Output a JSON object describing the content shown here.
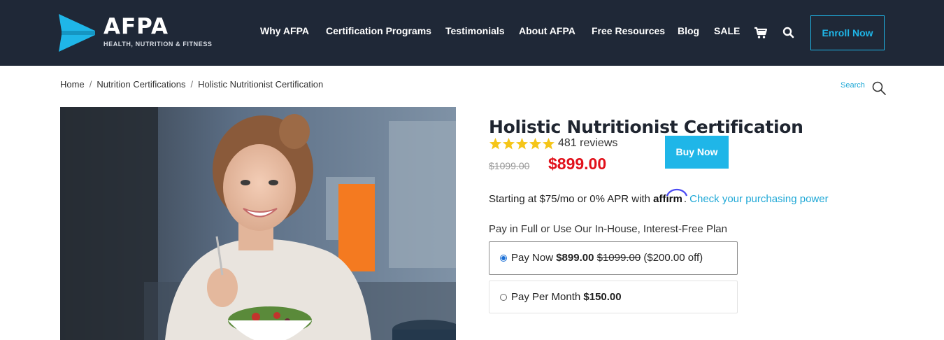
{
  "brand": {
    "name": "AFPA",
    "tagline": "HEALTH, NUTRITION & FITNESS"
  },
  "nav": {
    "items": [
      "Why AFPA",
      "Certification Programs",
      "Testimonials",
      "About AFPA",
      "Free Resources",
      "Blog",
      "SALE"
    ],
    "enroll_label": "Enroll Now"
  },
  "breadcrumb": {
    "items": [
      "Home",
      "Nutrition Certifications",
      "Holistic Nutritionist Certification"
    ],
    "separator": "/"
  },
  "search": {
    "label": "Search"
  },
  "product": {
    "title": "Holistic Nutritionist Certification",
    "rating": 5,
    "reviews": "481 reviews",
    "old_price": "$1099.00",
    "price": "$899.00",
    "buy_label": "Buy Now"
  },
  "financing": {
    "prefix": "Starting at $75/mo or 0% APR with",
    "brand": "affirm",
    "suffix": ".",
    "link": "Check your purchasing power"
  },
  "plans": {
    "heading": "Pay in Full or Use Our In-House, Interest-Free Plan",
    "options": [
      {
        "label": "Pay Now",
        "price": "$899.00",
        "old_price": "$1099.00",
        "note": "($200.00 off)",
        "selected": true
      },
      {
        "label": "Pay Per Month",
        "price": "$150.00",
        "selected": false
      }
    ]
  },
  "colors": {
    "header_bg": "#1f2837",
    "accent": "#1fb6e8",
    "sale_price": "#e1101a",
    "star": "#f5c518"
  },
  "icons": [
    "afpa-logo-mark",
    "cart-icon",
    "search-icon",
    "star-icon"
  ]
}
